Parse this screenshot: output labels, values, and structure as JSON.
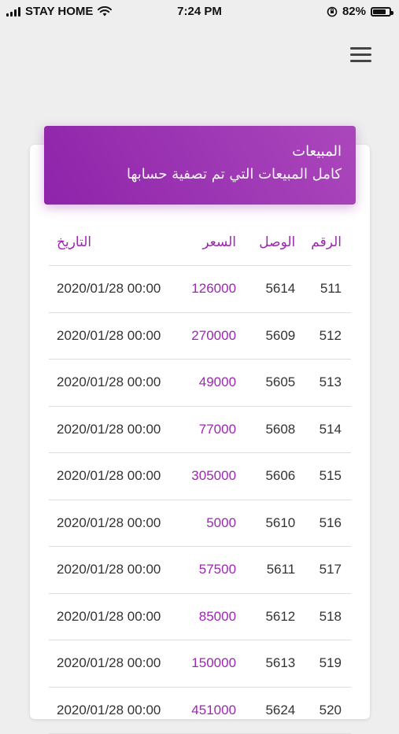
{
  "status_bar": {
    "carrier": "STAY HOME",
    "time": "7:24 PM",
    "battery": "82%",
    "battery_level": 0.82
  },
  "card": {
    "title": "المبيعات",
    "subtitle": "كامل المبيعات التي تم تصفية حسابها"
  },
  "table": {
    "headers": {
      "number": "الرقم",
      "receipt": "الوصل",
      "price": "السعر",
      "date": "التاريخ"
    },
    "rows": [
      {
        "number": "511",
        "receipt": "5614",
        "price": "126000",
        "date": "2020/01/28 00:00"
      },
      {
        "number": "512",
        "receipt": "5609",
        "price": "270000",
        "date": "2020/01/28 00:00"
      },
      {
        "number": "513",
        "receipt": "5605",
        "price": "49000",
        "date": "2020/01/28 00:00"
      },
      {
        "number": "514",
        "receipt": "5608",
        "price": "77000",
        "date": "2020/01/28 00:00"
      },
      {
        "number": "515",
        "receipt": "5606",
        "price": "305000",
        "date": "2020/01/28 00:00"
      },
      {
        "number": "516",
        "receipt": "5610",
        "price": "5000",
        "date": "2020/01/28 00:00"
      },
      {
        "number": "517",
        "receipt": "5611",
        "price": "57500",
        "date": "2020/01/28 00:00"
      },
      {
        "number": "518",
        "receipt": "5612",
        "price": "85000",
        "date": "2020/01/28 00:00"
      },
      {
        "number": "519",
        "receipt": "5613",
        "price": "150000",
        "date": "2020/01/28 00:00"
      },
      {
        "number": "520",
        "receipt": "5624",
        "price": "451000",
        "date": "2020/01/28 00:00"
      }
    ]
  },
  "colors": {
    "accent": "#9c27b0",
    "background": "#eeeeee"
  },
  "icons": {
    "menu": "hamburger-menu-icon",
    "wifi": "wifi-icon",
    "lock": "orientation-lock-icon"
  }
}
